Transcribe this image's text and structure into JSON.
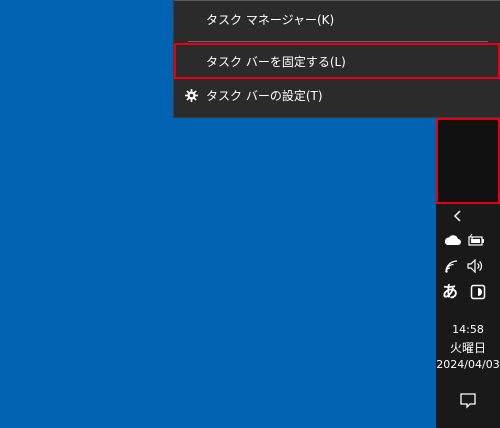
{
  "context_menu": {
    "items": [
      {
        "label": "タスク マネージャー(K)",
        "icon": null,
        "highlighted": false
      },
      {
        "label": "タスク バーを固定する(L)",
        "icon": null,
        "highlighted": true
      },
      {
        "label": "タスク バーの設定(T)",
        "icon": "gear-icon",
        "highlighted": false
      }
    ]
  },
  "taskbar": {
    "tray_icons": [
      "chevron-left-icon",
      "onedrive-cloud-icon",
      "battery-icon",
      "wifi-icon",
      "volume-icon",
      "ime-icon",
      "input-mode-icon"
    ],
    "ime_label": "あ",
    "clock": {
      "time": "14:58",
      "weekday": "火曜日",
      "date": "2024/04/03"
    },
    "notification_icon": "action-center-icon"
  },
  "colors": {
    "desktop": "#0063b1",
    "menu_bg": "#2b2b2b",
    "taskbar_bg": "#191919",
    "highlight_border": "#e60012"
  }
}
